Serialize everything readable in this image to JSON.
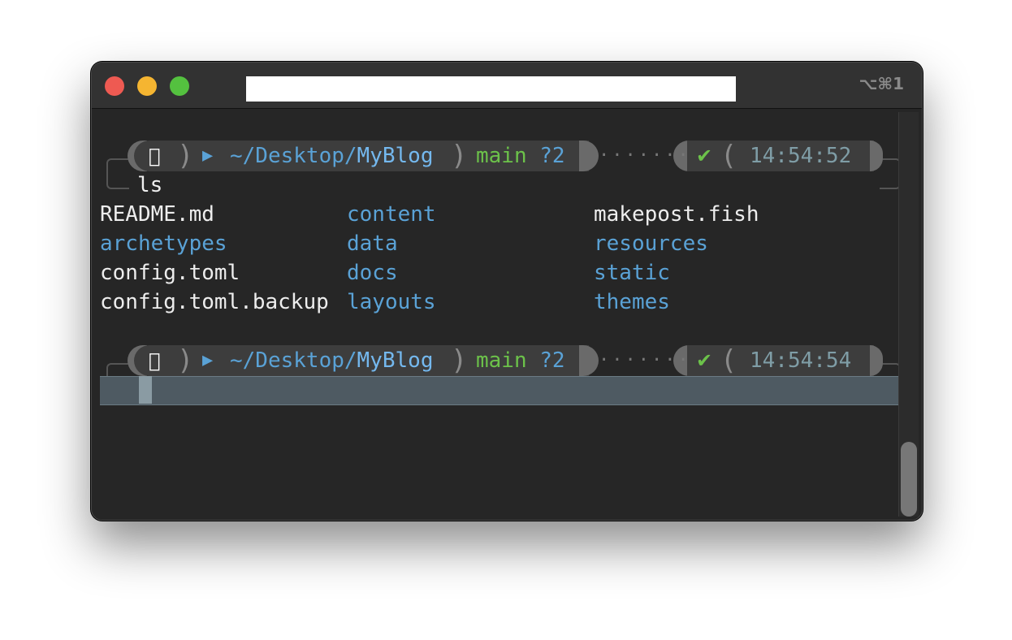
{
  "window": {
    "shortcut": "⌥⌘1"
  },
  "prompts": [
    {
      "icon": "apple-icon",
      "path_prefix": "~/Desktop/",
      "path_current": "MyBlog",
      "branch": "main",
      "status": "?2",
      "check": "✔",
      "time": "14:54:52"
    },
    {
      "icon": "apple-icon",
      "path_prefix": "~/Desktop/",
      "path_current": "MyBlog",
      "branch": "main",
      "status": "?2",
      "check": "✔",
      "time": "14:54:54"
    }
  ],
  "command": "ls",
  "listing": [
    [
      "README.md",
      "content",
      "makepost.fish"
    ],
    [
      "archetypes",
      "data",
      "resources"
    ],
    [
      "config.toml",
      "docs",
      "static"
    ],
    [
      "config.toml.backup",
      "layouts",
      "themes"
    ]
  ],
  "listing_types": [
    [
      "file",
      "dir",
      "file"
    ],
    [
      "dir",
      "dir",
      "dir"
    ],
    [
      "file",
      "dir",
      "dir"
    ],
    [
      "file",
      "dir",
      "dir"
    ]
  ],
  "colors": {
    "dir": "#5aa2d6",
    "file": "#ededed",
    "branch": "#6cc24a",
    "time": "#7f9da6"
  }
}
